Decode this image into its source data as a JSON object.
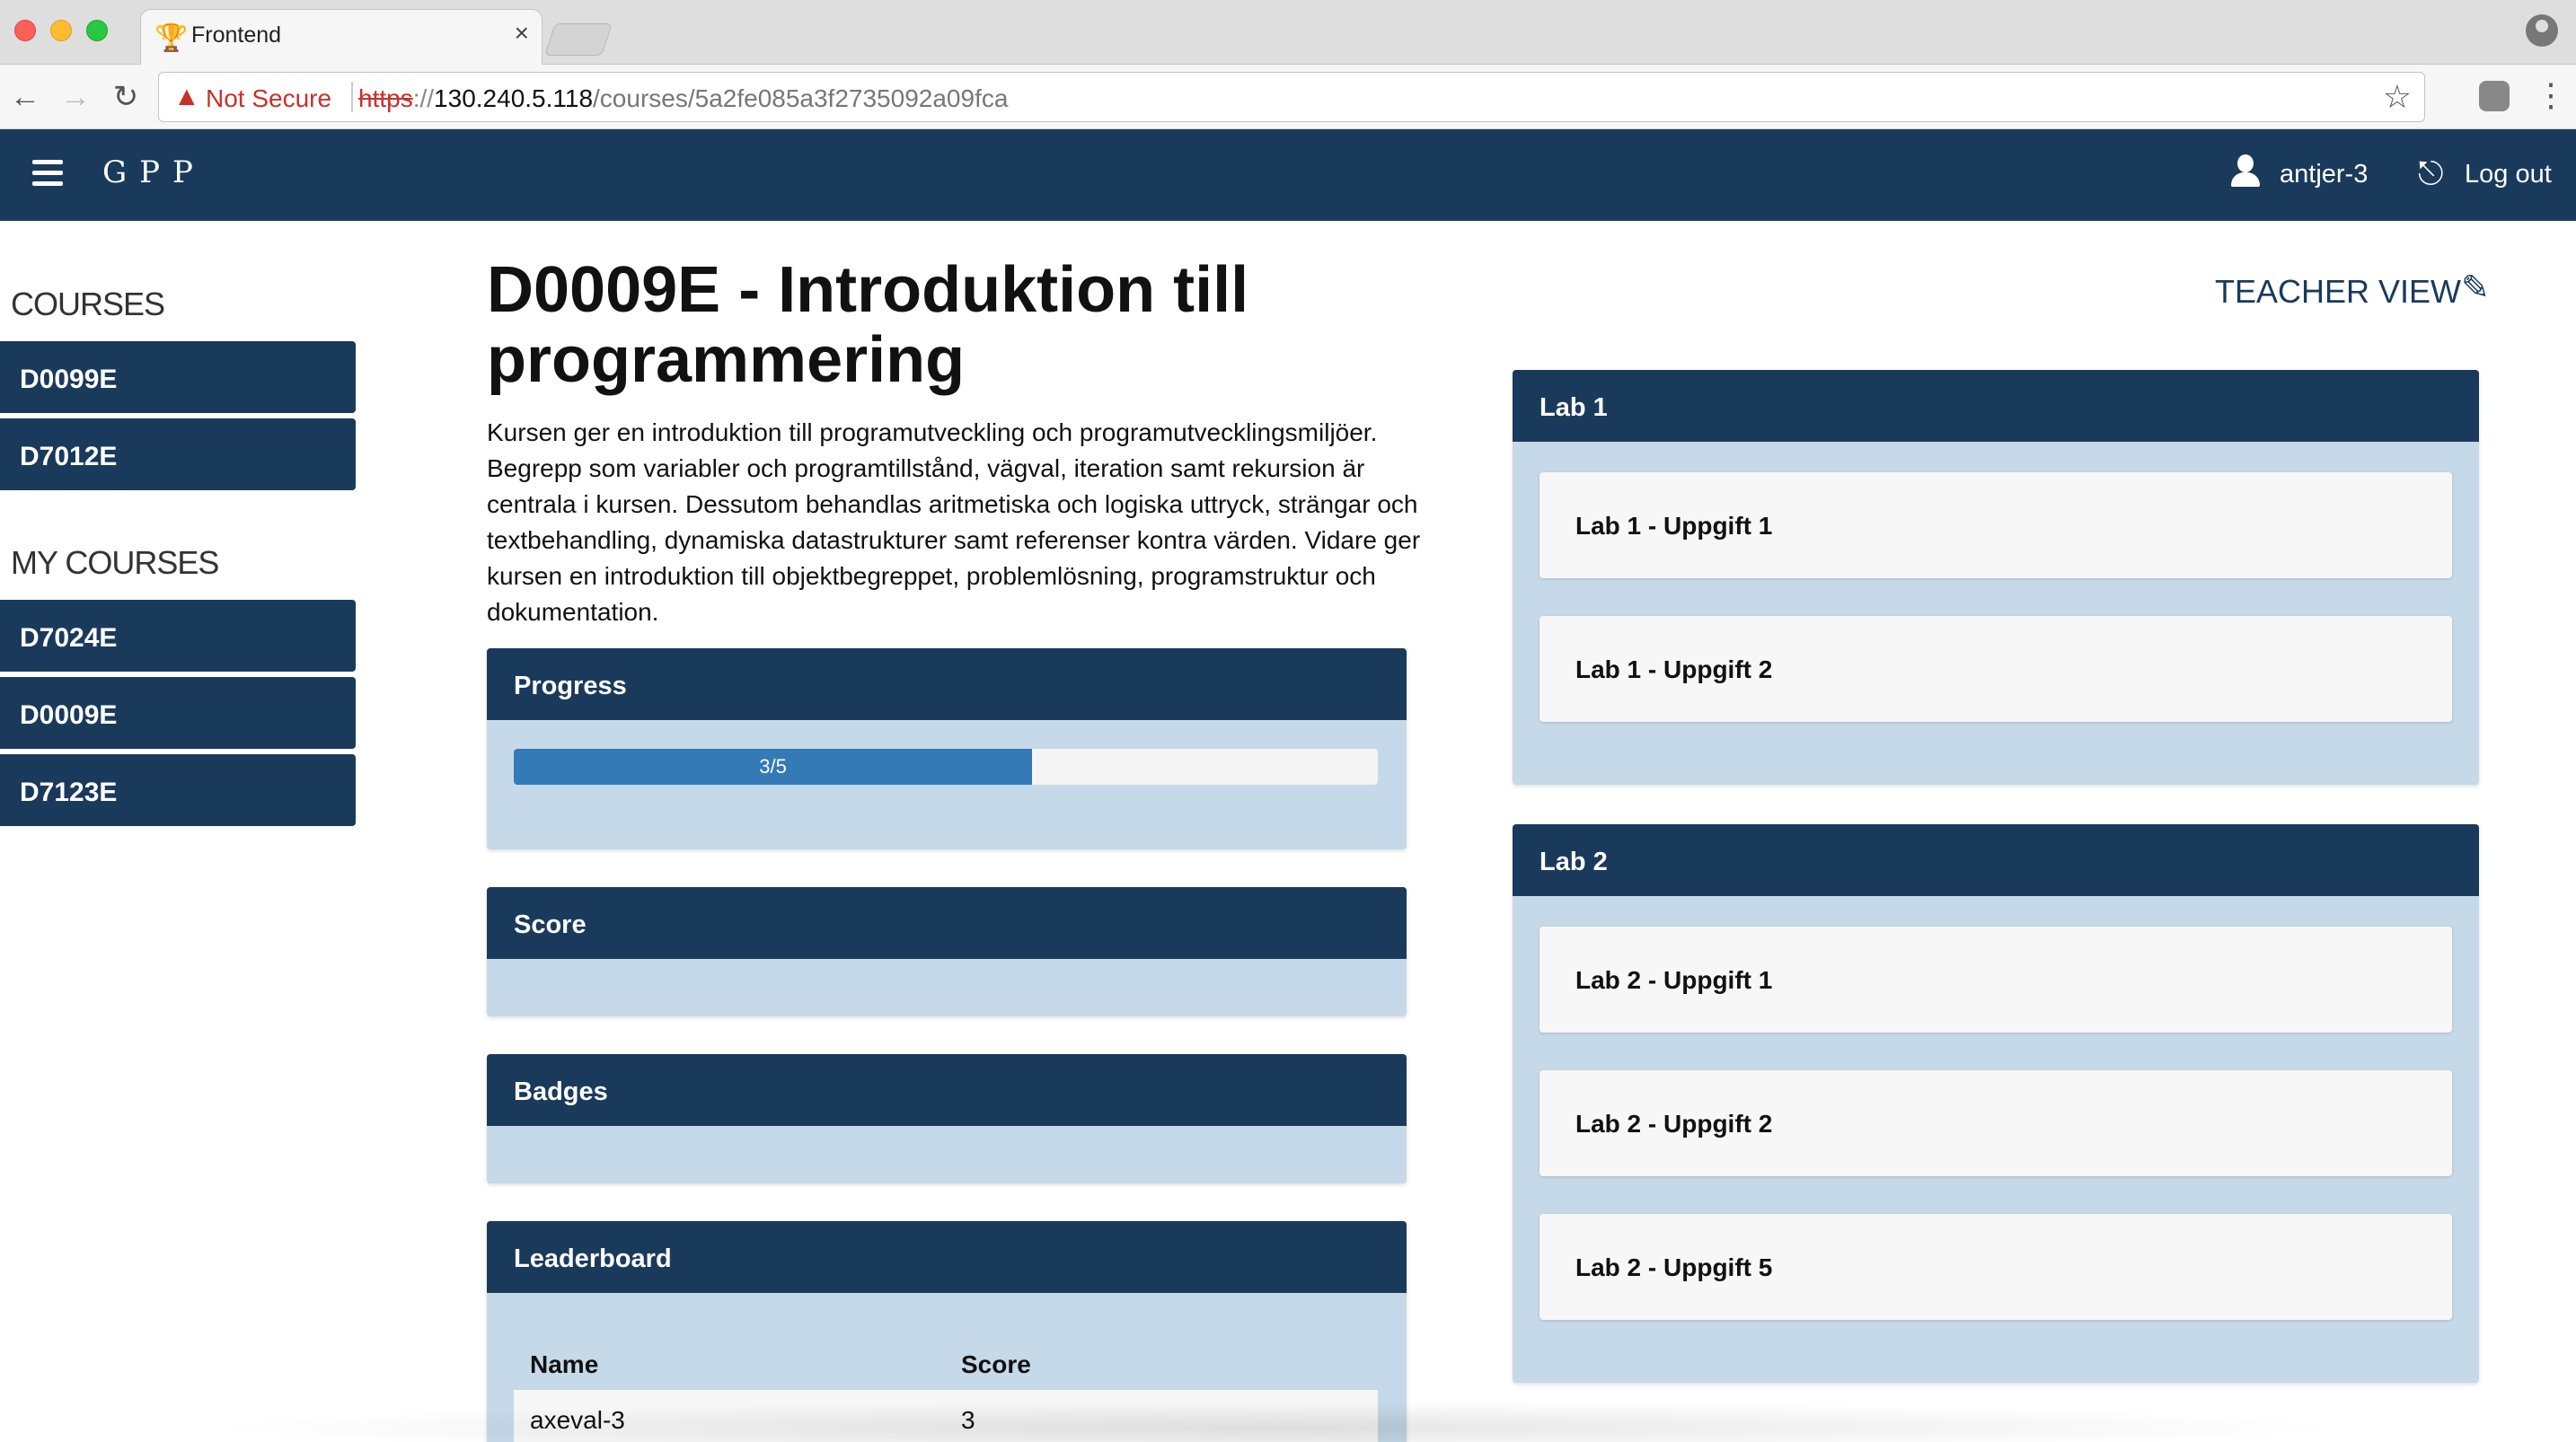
{
  "browser": {
    "tab_title": "Frontend",
    "tab_close": "×",
    "security_label": "Not Secure",
    "url_scheme": "https",
    "url_sep": "://",
    "url_host": "130.240.5.118",
    "url_path": "/courses/5a2fe085a3f2735092a09fca"
  },
  "navbar": {
    "brand": "GPP",
    "username": "antjer-3",
    "logout_label": "Log out"
  },
  "sidebar": {
    "courses_heading": "COURSES",
    "courses": [
      "D0099E",
      "D7012E"
    ],
    "my_courses_heading": "MY COURSES",
    "my_courses": [
      "D7024E",
      "D0009E",
      "D7123E"
    ]
  },
  "course": {
    "title": "D0009E - Introduktion till programmering",
    "description": "Kursen ger en introduktion till programutveckling och programutvecklingsmiljöer. Begrepp som variabler och programtillstånd, vägval, iteration samt rekursion är centrala i kursen. Dessutom behandlas aritmetiska och logiska uttryck, strängar och textbehandling, dynamiska datastrukturer samt referenser kontra värden. Vidare ger kursen en introduktion till objektbegreppet, problemlösning, programstruktur och dokumentation.",
    "teacher_view_label": "TEACHER VIEW"
  },
  "progress": {
    "heading": "Progress",
    "label": "3/5",
    "fraction": 0.6
  },
  "score": {
    "heading": "Score"
  },
  "badges": {
    "heading": "Badges"
  },
  "leaderboard": {
    "heading": "Leaderboard",
    "col_name": "Name",
    "col_score": "Score",
    "rows": [
      {
        "name": "axeval-3",
        "score": "3"
      }
    ]
  },
  "labs": [
    {
      "title": "Lab 1",
      "items": [
        "Lab 1 - Uppgift 1",
        "Lab 1 - Uppgift 2"
      ]
    },
    {
      "title": "Lab 2",
      "items": [
        "Lab 2 - Uppgift 1",
        "Lab 2 - Uppgift 2",
        "Lab 2 - Uppgift 5"
      ]
    }
  ],
  "colors": {
    "navbar_bg": "#1a3a5c",
    "panel_bg": "#c5d9e8",
    "progress_fill": "#337ab7",
    "warning_red": "#c9302c"
  },
  "icons": {
    "favicon": "trophy-icon",
    "user": "user-icon",
    "logout": "logout-icon",
    "teacher_view": "pencil-icon",
    "menu": "hamburger-icon"
  }
}
